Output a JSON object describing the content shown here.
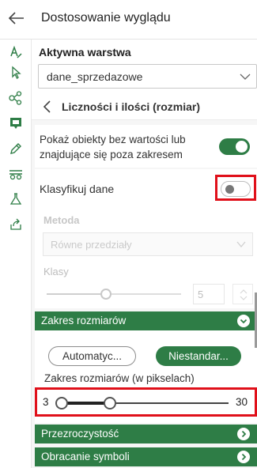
{
  "header": {
    "title": "Dostosowanie wyglądu"
  },
  "layer": {
    "label": "Aktywna warstwa",
    "value": "dane_sprzedazowe"
  },
  "section": {
    "title": "Liczności i ilości (rozmiar)"
  },
  "show_outside": {
    "label": "Pokaż obiekty bez wartości lub znajdujące się poza zakresem",
    "state": "on"
  },
  "classify": {
    "label": "Klasyfikuj dane",
    "state": "off"
  },
  "method": {
    "label": "Metoda",
    "value": "Równe przedziały"
  },
  "classes": {
    "label": "Klasy",
    "value": "5"
  },
  "size_range": {
    "title": "Zakres rozmiarów",
    "auto_button": "Automatyc...",
    "custom_button": "Niestandar...",
    "range_label": "Zakres rozmiarów (w pikselach)",
    "min": "3",
    "max": "30"
  },
  "transparency": {
    "title": "Przezroczystość"
  },
  "rotation": {
    "title": "Obracanie symboli"
  },
  "colors": {
    "accent": "#2e7d46",
    "highlight": "#e0101a"
  }
}
